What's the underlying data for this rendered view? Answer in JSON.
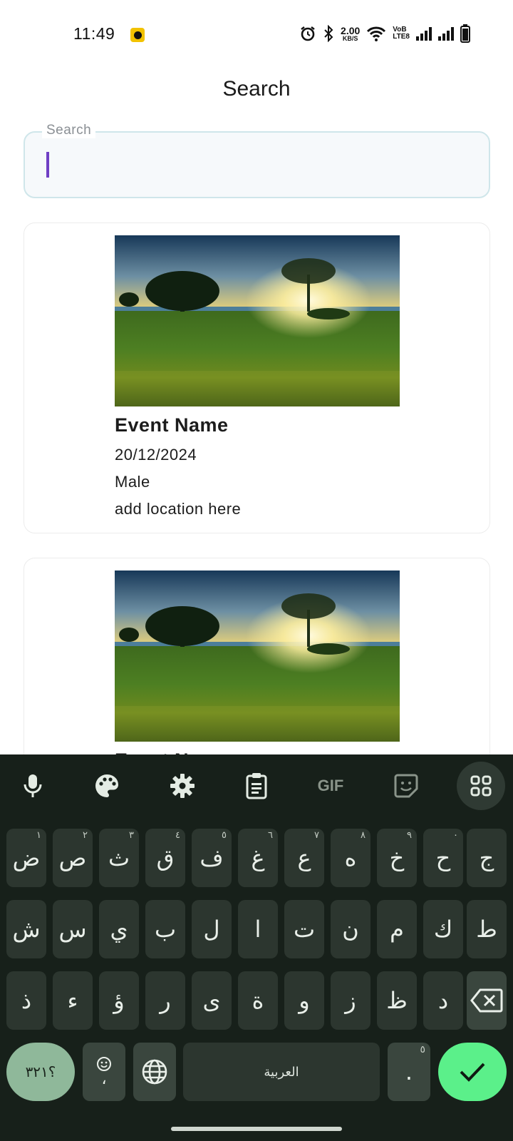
{
  "status_bar": {
    "time": "11:49",
    "net_speed_value": "2.00",
    "net_speed_unit": "KB/S",
    "volte_top": "VoB",
    "volte_bottom": "LTE8"
  },
  "header": {
    "title": "Search"
  },
  "search": {
    "label": "Search",
    "value": "",
    "placeholder": ""
  },
  "events": [
    {
      "name": "Event Name",
      "date": "20/12/2024",
      "gender": "Male",
      "location": "add location here"
    },
    {
      "name": "Event Name",
      "date": "",
      "gender": "",
      "location": ""
    }
  ],
  "keyboard": {
    "toolbar": {
      "gif_label": "GIF",
      "icons": [
        "microphone-icon",
        "palette-icon",
        "settings-icon",
        "clipboard-icon",
        "gif-icon",
        "sticker-icon",
        "apps-grid-icon"
      ]
    },
    "row1": [
      {
        "char": "ض",
        "hint": "١"
      },
      {
        "char": "ص",
        "hint": "٢"
      },
      {
        "char": "ث",
        "hint": "٣"
      },
      {
        "char": "ق",
        "hint": "٤"
      },
      {
        "char": "ف",
        "hint": "٥"
      },
      {
        "char": "غ",
        "hint": "٦"
      },
      {
        "char": "ع",
        "hint": "٧"
      },
      {
        "char": "ه",
        "hint": "٨"
      },
      {
        "char": "خ",
        "hint": "٩"
      },
      {
        "char": "ح",
        "hint": "٠"
      },
      {
        "char": "ج",
        "hint": ""
      }
    ],
    "row2": [
      "ش",
      "س",
      "ي",
      "ب",
      "ل",
      "ا",
      "ت",
      "ن",
      "م",
      "ك",
      "ط"
    ],
    "row3": [
      "ذ",
      "ء",
      "ؤ",
      "ر",
      "ى",
      "ة",
      "و",
      "ز",
      "ظ",
      "د"
    ],
    "symbols_label": "؟٣٢١",
    "emoji_comma": "،",
    "space_label": "العربية",
    "period": ".",
    "period_hint": "٥"
  },
  "colors": {
    "accent": "#6f3fc4",
    "keyboard_bg": "#17201a",
    "key_bg": "#2c362f",
    "enter_key": "#5bf08a",
    "symbols_key": "#8fb89a",
    "search_border": "#cfe6ea"
  }
}
